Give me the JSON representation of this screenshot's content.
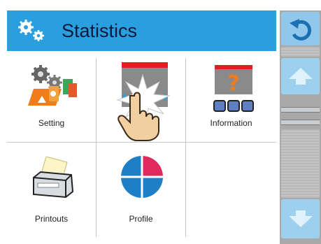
{
  "header": {
    "title": "Statistics",
    "icon": "gears-icon"
  },
  "menu": {
    "items": [
      {
        "label": "Setting",
        "icon": "setting-icon"
      },
      {
        "label": "",
        "icon": "reset-icon"
      },
      {
        "label": "Information",
        "icon": "information-icon"
      },
      {
        "label": "Printouts",
        "icon": "printer-icon"
      },
      {
        "label": "Profile",
        "icon": "profile-icon"
      }
    ]
  },
  "sidebar": {
    "buttons": [
      "back-icon",
      "arrow-up-icon",
      "arrow-down-icon"
    ]
  },
  "colors": {
    "header": "#2a9fe0",
    "sidebar_button": "#9dd0ee",
    "sidebar_bg": "#a9a9a9",
    "accent_red": "#e53935"
  }
}
